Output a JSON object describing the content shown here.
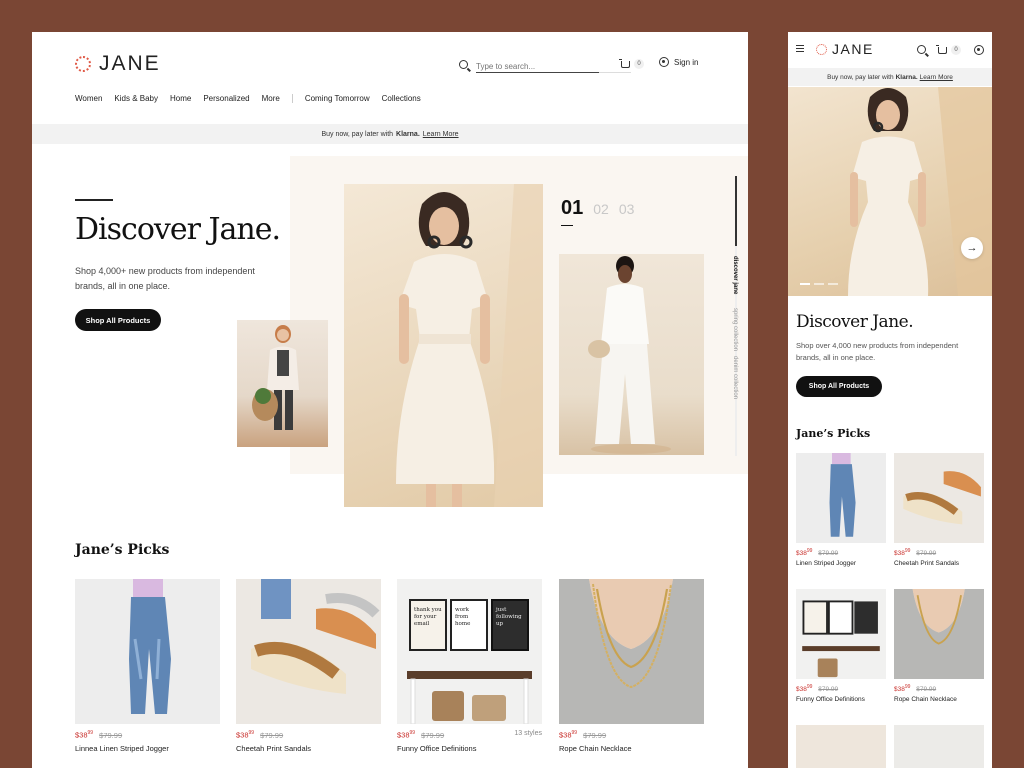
{
  "brand": {
    "name": "JANE"
  },
  "header": {
    "search_placeholder": "Type to search...",
    "cart_count": "0",
    "signin_label": "Sign in"
  },
  "nav": [
    "Women",
    "Kids & Baby",
    "Home",
    "Personalized",
    "More",
    "Coming Tomorrow",
    "Collections"
  ],
  "promo": {
    "prefix": "Buy now, pay later with",
    "brand": "Klarna.",
    "link": "Learn More"
  },
  "hero": {
    "title": "Discover Jane.",
    "subtitle": "Shop 4,000+ new products from independent brands, all in one place.",
    "cta": "Shop All Products",
    "slides": [
      "01",
      "02",
      "03"
    ],
    "side_labels": [
      "discover jane",
      "spring collection",
      "denim collection"
    ]
  },
  "picks": {
    "title": "Jane’s Picks",
    "items": [
      {
        "price_main": "$38",
        "price_cents": "99",
        "old_price": "$79.99",
        "name": "Linnea Linen Striped Jogger",
        "styles": ""
      },
      {
        "price_main": "$38",
        "price_cents": "99",
        "old_price": "$79.99",
        "name": "Cheetah Print Sandals",
        "styles": ""
      },
      {
        "price_main": "$38",
        "price_cents": "99",
        "old_price": "$79.99",
        "name": "Funny Office Definitions",
        "styles": "13 styles"
      },
      {
        "price_main": "$38",
        "price_cents": "99",
        "old_price": "$79.99",
        "name": "Rope Chain Necklace",
        "styles": ""
      }
    ]
  },
  "mobile": {
    "subtitle": "Shop over 4,000 new products from independent brands, all in one place.",
    "items": [
      {
        "price_main": "$38",
        "price_cents": "99",
        "old_price": "$79.99",
        "name": "Linen Striped Jogger"
      },
      {
        "price_main": "$38",
        "price_cents": "99",
        "old_price": "$79.99",
        "name": "Cheetah Print Sandals"
      },
      {
        "price_main": "$38",
        "price_cents": "99",
        "old_price": "$79.99",
        "name": "Funny Office Definitions"
      },
      {
        "price_main": "$38",
        "price_cents": "99",
        "old_price": "$79.99",
        "name": "Rope Chain Necklace"
      }
    ]
  },
  "frames": {
    "desk_poster_1": "thank you for your email",
    "desk_poster_2": "work from home",
    "desk_poster_3": "just following up"
  },
  "colors": {
    "background": "#7a4634",
    "accent": "#e05a47",
    "price": "#c9302c",
    "button": "#111111"
  },
  "icons": [
    "search-icon",
    "cart-icon",
    "user-icon",
    "menu-icon",
    "arrow-right-icon"
  ]
}
